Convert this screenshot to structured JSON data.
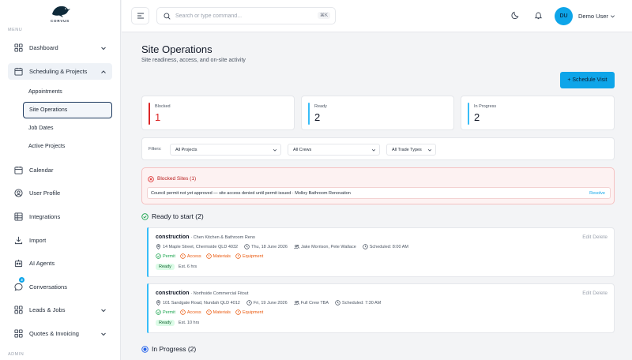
{
  "brand": {
    "name": "CORVUS"
  },
  "sidebar": {
    "menu_label": "MENU",
    "admin_label": "ADMIN",
    "items": [
      {
        "label": "Dashboard"
      },
      {
        "label": "Scheduling & Projects"
      },
      {
        "label": "Calendar"
      },
      {
        "label": "User Profile"
      },
      {
        "label": "Integrations"
      },
      {
        "label": "Import"
      },
      {
        "label": "AI Agents"
      },
      {
        "label": "Conversations",
        "badge": "3"
      },
      {
        "label": "Leads & Jobs"
      },
      {
        "label": "Quotes & Invoicing"
      }
    ],
    "sub_items": [
      {
        "label": "Appointments"
      },
      {
        "label": "Site Operations"
      },
      {
        "label": "Job Dates"
      },
      {
        "label": "Active Projects"
      }
    ]
  },
  "header": {
    "search_placeholder": "Search or type command...",
    "search_shortcut": "⌘K",
    "user_initials": "DU",
    "user_name": "Demo User"
  },
  "page": {
    "title": "Site Operations",
    "subtitle": "Site readiness, access, and on-site activity",
    "primary_action": "+ Schedule Visit"
  },
  "stats": [
    {
      "label": "Blocked",
      "value": "1",
      "color": "#dc2626"
    },
    {
      "label": "Ready",
      "value": "2",
      "color": "#38bdf8"
    },
    {
      "label": "In Progress",
      "value": "2",
      "color": "#38bdf8"
    }
  ],
  "filters": {
    "label": "Filters:",
    "projects": "All Projects",
    "crews": "All Crews",
    "trades": "All Trade Types"
  },
  "blocked": {
    "title": "Blocked Sites (1)",
    "message": "Council permit not yet approved — site access denied until permit issued · Molloy Bathroom Renovation",
    "action": "Resolve"
  },
  "ready_section": {
    "title": "Ready to start (2)"
  },
  "in_progress_section": {
    "title": "In Progress (2)"
  },
  "cards": [
    {
      "type": "construction",
      "name": "· Chen Kitchen & Bathroom Reno",
      "address": "14 Maple Street, Chermside QLD 4032",
      "date": "Thu, 18 June 2026",
      "crew": "Jake Morrison, Pete Wallace",
      "scheduled": "Scheduled: 8:00 AM",
      "checks": [
        "Permit",
        "Access",
        "Materials",
        "Equipment"
      ],
      "status": "Ready",
      "estimate": "Est. 6 hrs",
      "actions": "Edit Delete"
    },
    {
      "type": "construction",
      "name": "· Northside Commercial Fitout",
      "address": "101 Sandgate Road, Nundah QLD 4012",
      "date": "Fri, 19 June 2026",
      "crew": "Full Crew TBA",
      "scheduled": "Scheduled: 7:30 AM",
      "checks": [
        "Permit",
        "Access",
        "Materials",
        "Equipment"
      ],
      "status": "Ready",
      "estimate": "Est. 10 hrs",
      "actions": "Edit Delete"
    }
  ]
}
